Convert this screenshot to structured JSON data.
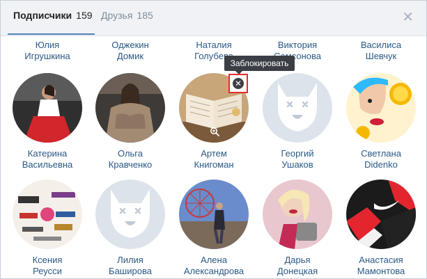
{
  "tabs": [
    {
      "label": "Подписчики",
      "count": "159"
    },
    {
      "label": "Друзья",
      "count": "185"
    }
  ],
  "close_glyph": "✕",
  "tooltip": "Заблокировать",
  "block_glyph": "✕",
  "rows": [
    [
      {
        "first": "Юлия",
        "last": "Игрушкина"
      },
      {
        "first": "Оджекин",
        "last": "Домик"
      },
      {
        "first": "Наталия",
        "last": "Голубева"
      },
      {
        "first": "Виктория",
        "last": "Самсонова"
      },
      {
        "first": "Василиса",
        "last": "Шевчук"
      }
    ],
    [
      {
        "first": "Катерина",
        "last": "Васильевна",
        "icon": "photo-woman-red-skirt"
      },
      {
        "first": "Ольга",
        "last": "Кравченко",
        "icon": "photo-woman-fur"
      },
      {
        "first": "Артем",
        "last": "Книгоман",
        "icon": "photo-open-book"
      },
      {
        "first": "Георгий",
        "last": "Ушаков",
        "icon": "default-avatar-dog"
      },
      {
        "first": "Светлана",
        "last": "Didenko",
        "icon": "photo-woman-lemon"
      }
    ],
    [
      {
        "first": "Ксения",
        "last": "Реусси",
        "icon": "photo-brand-logos"
      },
      {
        "first": "Лилия",
        "last": "Баширова",
        "icon": "default-avatar-dog"
      },
      {
        "first": "Алена",
        "last": "Александрова",
        "icon": "photo-woman-ferris-wheel"
      },
      {
        "first": "Дарья",
        "last": "Донецкая",
        "icon": "photo-woman-pink"
      },
      {
        "first": "Анастасия",
        "last": "Мамонтова",
        "icon": "photo-nike-jacket"
      }
    ]
  ],
  "colors": {
    "link": "#2a5885",
    "header_bg": "#f0f2f5",
    "accent": "#5181b8",
    "highlight": "#e52b2b"
  }
}
